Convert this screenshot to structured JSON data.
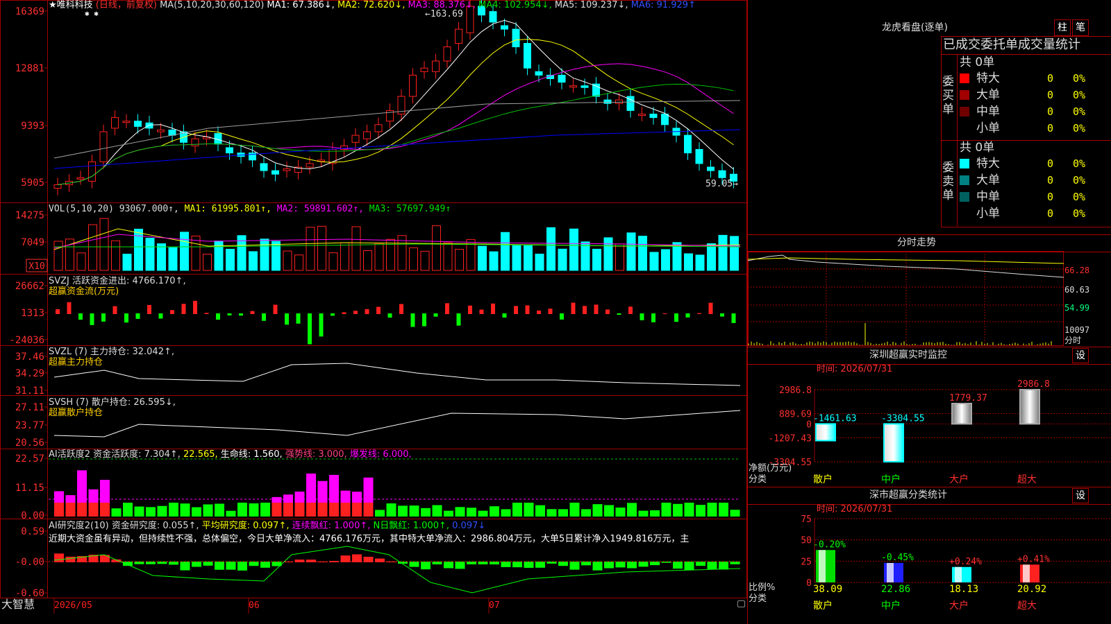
{
  "colors": {
    "up": "#ff2020",
    "down": "#00ffff",
    "grid": "#a00000",
    "ma1": "#ffffff",
    "ma2": "#ffff00",
    "ma3": "#ff00ff",
    "ma4": "#00c000",
    "ma5": "#a0a0a0",
    "ma6": "#0000ff"
  },
  "main": {
    "star_name": "★唯科科技",
    "mode": "(日线，前复权)",
    "ma_params": "MA(5,10,20,30,60,120)",
    "ma1": "MA1: 67.386↓,",
    "ma2": "MA2: 72.620↓,",
    "ma3": "MA3: 88.376↓,",
    "ma4": "MA4: 102.954↓,",
    "ma5": "MA5: 109.237↓,",
    "ma6": "MA6: 91.929↑",
    "y_ticks": [
      "16369",
      "12881",
      "9393",
      "5905"
    ],
    "high_label": "←163.69",
    "low_label": "59.05→",
    "flags": "✱ ✱"
  },
  "vol": {
    "title": "VOL(5,10,20)  93067.000↑,",
    "ma1": "MA1: 61995.801↑,",
    "ma2": "MA2: 59891.602↑,",
    "ma3": "MA3: 57697.949↑",
    "y_ticks": [
      "14275",
      "7049"
    ],
    "unit": "X10"
  },
  "svzj": {
    "title": "SVZJ  活跃资金进出: 4766.170↑,",
    "sub": "超赢资金流(万元)",
    "y_ticks": [
      "26662",
      "1313",
      "-24036"
    ]
  },
  "svzl": {
    "title": "SVZL (7) 主力持仓: 32.042↑,",
    "sub": "超赢主力持仓",
    "y_ticks": [
      "37.46",
      "34.29",
      "31.11"
    ]
  },
  "svsh": {
    "title": "SVSH (7) 散户持仓: 26.595↓,",
    "sub": "超赢散户持仓",
    "y_ticks": [
      "27.11",
      "23.77",
      "20.56"
    ]
  },
  "ai_active": {
    "title": "AI活跃度2 资金活跃度: 7.304↑,",
    "v2": "22.565,",
    "life": "生命线: 1.560,",
    "strong": "强势线: 3.000,",
    "burst": "爆发线: 6.000,",
    "y_ticks": [
      "22.57",
      "11.15",
      "0.00"
    ]
  },
  "ai_research": {
    "title": "AI研究度2(10) 资金研究度: 0.055↑,",
    "avg": "平均研究度: 0.097↑,",
    "red": "连续飘红: 1.000↑,",
    "nred": "N日飘红: 1.000↑,",
    "last": "0.097↓",
    "text": "近期大资金虽有异动，但持续性不强，总体偏空，今日大单净流入：4766.176万元，其中特大单净流入：2986.804万元，大单5日累计净入1949.816万元，主",
    "y_ticks": [
      "0.59",
      "-0.00",
      "-0.60"
    ]
  },
  "bottom_axis": {
    "brand": "大智慧",
    "labels": [
      "2026/05",
      "06",
      "07"
    ]
  },
  "right": {
    "lhb_title": "龙虎看盘(逐单)",
    "btn_bar": "柱",
    "btn_pen": "笔",
    "tab_header": "已成交委托单成交量统计",
    "buy": {
      "side": "委买单",
      "total": "共 0单",
      "rows": [
        {
          "label": "特大",
          "count": "0",
          "pct": "0%",
          "color": "#ff0000"
        },
        {
          "label": "大单",
          "count": "0",
          "pct": "0%",
          "color": "#a00000"
        },
        {
          "label": "中单",
          "count": "0",
          "pct": "0%",
          "color": "#700000"
        },
        {
          "label": "小单",
          "count": "0",
          "pct": "0%",
          "color": ""
        }
      ]
    },
    "sell": {
      "side": "委卖单",
      "total": "共 0单",
      "rows": [
        {
          "label": "特大",
          "count": "0",
          "pct": "0%",
          "color": "#00ffff"
        },
        {
          "label": "大单",
          "count": "0",
          "pct": "0%",
          "color": "#008080"
        },
        {
          "label": "中单",
          "count": "0",
          "pct": "0%",
          "color": "#006060"
        },
        {
          "label": "小单",
          "count": "0",
          "pct": "0%",
          "color": ""
        }
      ]
    },
    "intraday_title": "分时走势",
    "intraday_ticks": [
      "66.28",
      "60.63",
      "54.99",
      "10097",
      "分时"
    ],
    "sz_monitor": {
      "title": "深圳超赢实时监控",
      "btn": "设",
      "time": "时间: 2026/07/31",
      "y_ticks": [
        "2986.8",
        "889.69",
        "0",
        "-1207.43",
        "-3304.55"
      ],
      "ylabel1": "净额(万元)",
      "ylabel2": "分类",
      "cats": [
        "散户",
        "中户",
        "大户",
        "超大"
      ],
      "values": [
        "-1461.63",
        "-3304.55",
        "1779.37",
        "2986.8"
      ]
    },
    "sz_stats": {
      "title": "深市超赢分类统计",
      "btn": "设",
      "time": "时间: 2026/07/31",
      "y_ticks": [
        "75",
        "50",
        "25",
        "0"
      ],
      "ylabel1": "比例%",
      "ylabel2": "分类",
      "cats": [
        "散户",
        "中户",
        "大户",
        "超大"
      ],
      "pcts": [
        "38.09",
        "22.86",
        "18.13",
        "20.92"
      ],
      "changes": [
        "-0.20%",
        "-0.45%",
        "+0.24%",
        "+0.41%"
      ]
    }
  },
  "chart_data": [
    {
      "type": "bar",
      "title": "深圳超赢实时监控",
      "categories": [
        "散户",
        "中户",
        "大户",
        "超大"
      ],
      "values": [
        -1461.63,
        -3304.55,
        1779.37,
        2986.8
      ],
      "ylabel": "净额(万元)",
      "ylim": [
        -3304.55,
        2986.8
      ]
    },
    {
      "type": "bar",
      "title": "深市超赢分类统计",
      "categories": [
        "散户",
        "中户",
        "大户",
        "超大"
      ],
      "values": [
        38.09,
        22.86,
        18.13,
        20.92
      ],
      "ylabel": "比例%",
      "ylim": [
        0,
        75
      ]
    }
  ]
}
